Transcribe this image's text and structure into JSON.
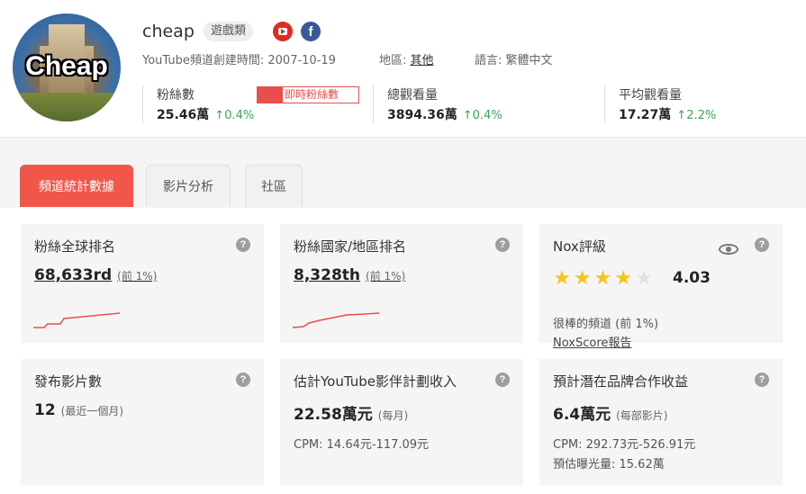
{
  "channel": {
    "avatar_text": "Cheap",
    "name": "cheap",
    "category": "遊戲類",
    "created_label": "YouTube頻道創建時間:",
    "created_date": "2007-10-19",
    "region_label": "地區:",
    "region_value": "其他",
    "language_label": "語言:",
    "language_value": "繁體中文"
  },
  "icons": {
    "youtube": "youtube-icon",
    "facebook": "facebook-icon"
  },
  "stats": {
    "subscribers": {
      "label": "粉絲數",
      "value": "25.46萬",
      "change": "↑0.4%"
    },
    "live_button": "即時粉絲數",
    "views": {
      "label": "總觀看量",
      "value": "3894.36萬",
      "change": "↑0.4%"
    },
    "avg_views": {
      "label": "平均觀看量",
      "value": "17.27萬",
      "change": "↑2.2%"
    }
  },
  "tabs": [
    "頻道統計數據",
    "影片分析",
    "社區"
  ],
  "cards": {
    "global_rank": {
      "title": "粉絲全球排名",
      "value": "68,633rd",
      "note": "(前 1%)",
      "help": "?"
    },
    "country_rank": {
      "title": "粉絲國家/地區排名",
      "value": "8,328th",
      "note": "(前 1%)",
      "help": "?"
    },
    "nox": {
      "title": "Nox評級",
      "stars": 4,
      "stars_total": 5,
      "score": "4.03",
      "desc": "很棒的頻道 (前 1%)",
      "report": "NoxScore報告",
      "help": "?"
    },
    "videos": {
      "title": "發布影片數",
      "value": "12",
      "note": "(最近一個月)",
      "help": "?"
    },
    "income": {
      "title": "估計YouTube影伴計劃收入",
      "value": "22.58萬元",
      "note": "(每月)",
      "cpm": "CPM: 14.64元-117.09元",
      "help": "?"
    },
    "brand": {
      "title": "預計潛在品牌合作收益",
      "value": "6.4萬元",
      "note": "(每部影片)",
      "cpm": "CPM: 292.73元-526.91元",
      "exposure": "預估曝光量: 15.62萬",
      "help": "?"
    }
  },
  "colors": {
    "accent": "#f0574a",
    "up": "#3aa35b",
    "star": "#f5c518"
  }
}
